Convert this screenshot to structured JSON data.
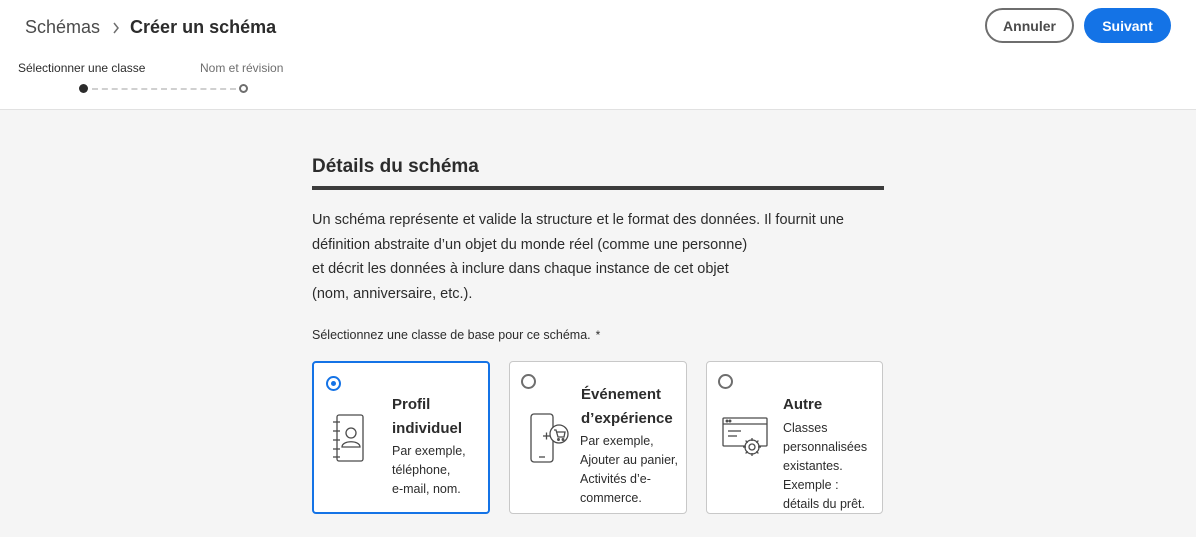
{
  "breadcrumb": {
    "parent": "Schémas",
    "current": "Créer un schéma"
  },
  "buttons": {
    "cancel": "Annuler",
    "next": "Suivant"
  },
  "steps": [
    {
      "label": "Sélectionner une classe",
      "active": true
    },
    {
      "label": "Nom et révision",
      "active": false
    }
  ],
  "section": {
    "title": "Détails du schéma",
    "description_lines": [
      "Un schéma représente et valide la structure et le format des données. Il fournit une",
      "définition abstraite d’un objet du monde réel (comme une personne)",
      "et décrit les données à inclure dans chaque instance de cet objet",
      "(nom, anniversaire, etc.)."
    ],
    "select_label": "Sélectionnez une classe de base pour ce schéma.",
    "required_mark": "*"
  },
  "classes": [
    {
      "selected": true,
      "icon": "address-book-icon",
      "title_lines": [
        "Profil",
        "individuel"
      ],
      "desc_lines": [
        "Par exemple,",
        "téléphone,",
        "e-mail, nom."
      ]
    },
    {
      "selected": false,
      "icon": "mobile-cart-icon",
      "title_lines": [
        "Événement",
        "d’expérience"
      ],
      "desc_lines": [
        "Par exemple,",
        "Ajouter au panier,",
        "Activités d’e-",
        "commerce."
      ]
    },
    {
      "selected": false,
      "icon": "window-gear-icon",
      "title_lines": [
        "Autre"
      ],
      "desc_lines": [
        "Classes",
        "personnalisées",
        "existantes.",
        "Exemple :",
        "détails du prêt."
      ]
    }
  ],
  "colors": {
    "accent": "#1473e6",
    "text": "#2c2c2c",
    "background": "#f5f5f5"
  }
}
